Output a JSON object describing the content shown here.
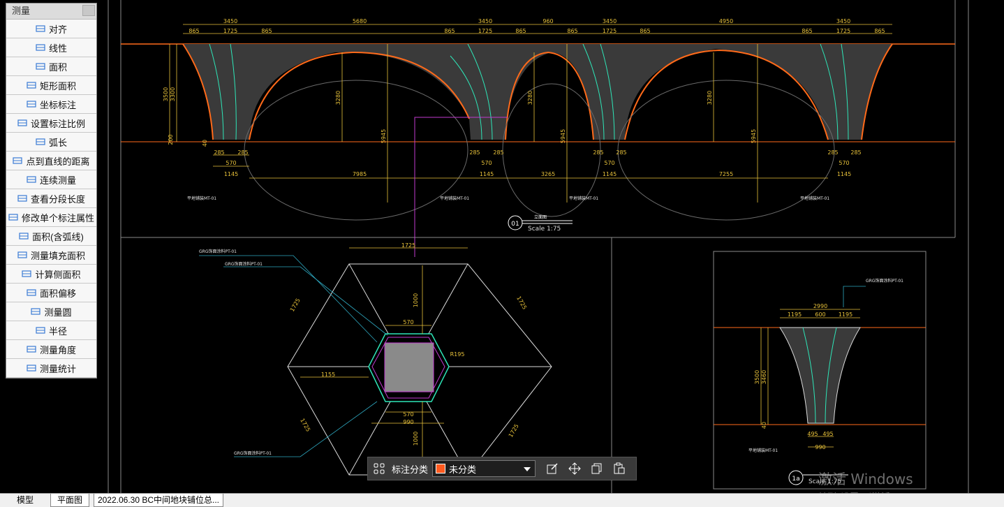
{
  "panel": {
    "title": "测量",
    "tools": [
      {
        "label": "对齐",
        "icon": "align-icon"
      },
      {
        "label": "线性",
        "icon": "linear-dimension-icon"
      },
      {
        "label": "面积",
        "icon": "area-icon"
      },
      {
        "label": "矩形面积",
        "icon": "rect-area-icon"
      },
      {
        "label": "坐标标注",
        "icon": "coordinate-icon"
      },
      {
        "label": "设置标注比例",
        "icon": "scale-setting-icon"
      },
      {
        "label": "弧长",
        "icon": "arc-length-icon"
      },
      {
        "label": "点到直线的距离",
        "icon": "point-line-distance-icon"
      },
      {
        "label": "连续测量",
        "icon": "continuous-measure-icon"
      },
      {
        "label": "查看分段长度",
        "icon": "segment-length-icon"
      },
      {
        "label": "修改单个标注属性",
        "icon": "edit-dimension-icon"
      },
      {
        "label": "面积(含弧线)",
        "icon": "arc-area-icon"
      },
      {
        "label": "测量填充面积",
        "icon": "fill-area-icon"
      },
      {
        "label": "计算侧面积",
        "icon": "side-area-icon"
      },
      {
        "label": "面积偏移",
        "icon": "area-offset-icon"
      },
      {
        "label": "测量圆",
        "icon": "circle-measure-icon"
      },
      {
        "label": "半径",
        "icon": "radius-icon"
      },
      {
        "label": "测量角度",
        "icon": "angle-icon"
      },
      {
        "label": "测量统计",
        "icon": "statistics-icon"
      }
    ]
  },
  "tabs": {
    "model": "模型",
    "plan": "平面图",
    "file": "2022.06.30 BC中间地块铺位总..."
  },
  "annotation_toolbar": {
    "label": "标注分类",
    "selected": "未分类",
    "swatch_color": "#ff5a1f"
  },
  "watermark": {
    "line1": "激活 Windows",
    "line2": "转到\"设置\"以激活 Windows。"
  },
  "drawing": {
    "top_dims": [
      "3450",
      "5680",
      "3450",
      "960",
      "3450",
      "4950",
      "3450"
    ],
    "sub_dims": [
      "865",
      "1725",
      "865"
    ],
    "heights": [
      "3500",
      "3300",
      "3280",
      "5945",
      "300",
      "200",
      "40"
    ],
    "bottom_dims": [
      "285",
      "570",
      "1145",
      "7985",
      "3265",
      "7255"
    ],
    "label_mt": "平地铺装MT-01",
    "section_no": "01",
    "section_label": "立面图",
    "scale": "Scale 1:75",
    "hex_dims": [
      "1725",
      "1000",
      "570",
      "1155",
      "990",
      "R195"
    ],
    "pt_label": "GRG饰面涂料PT-01",
    "side_section_no": "1a",
    "side_dims": [
      "2990",
      "1195",
      "600",
      "1195",
      "3500",
      "3460",
      "495",
      "990",
      "40"
    ]
  },
  "colors": {
    "orange": "#ff6a1a",
    "cyan": "#2ee6b8",
    "yellow": "#e8c23a",
    "magenta": "#c23ad0",
    "gray_line": "#7a7a7a"
  }
}
